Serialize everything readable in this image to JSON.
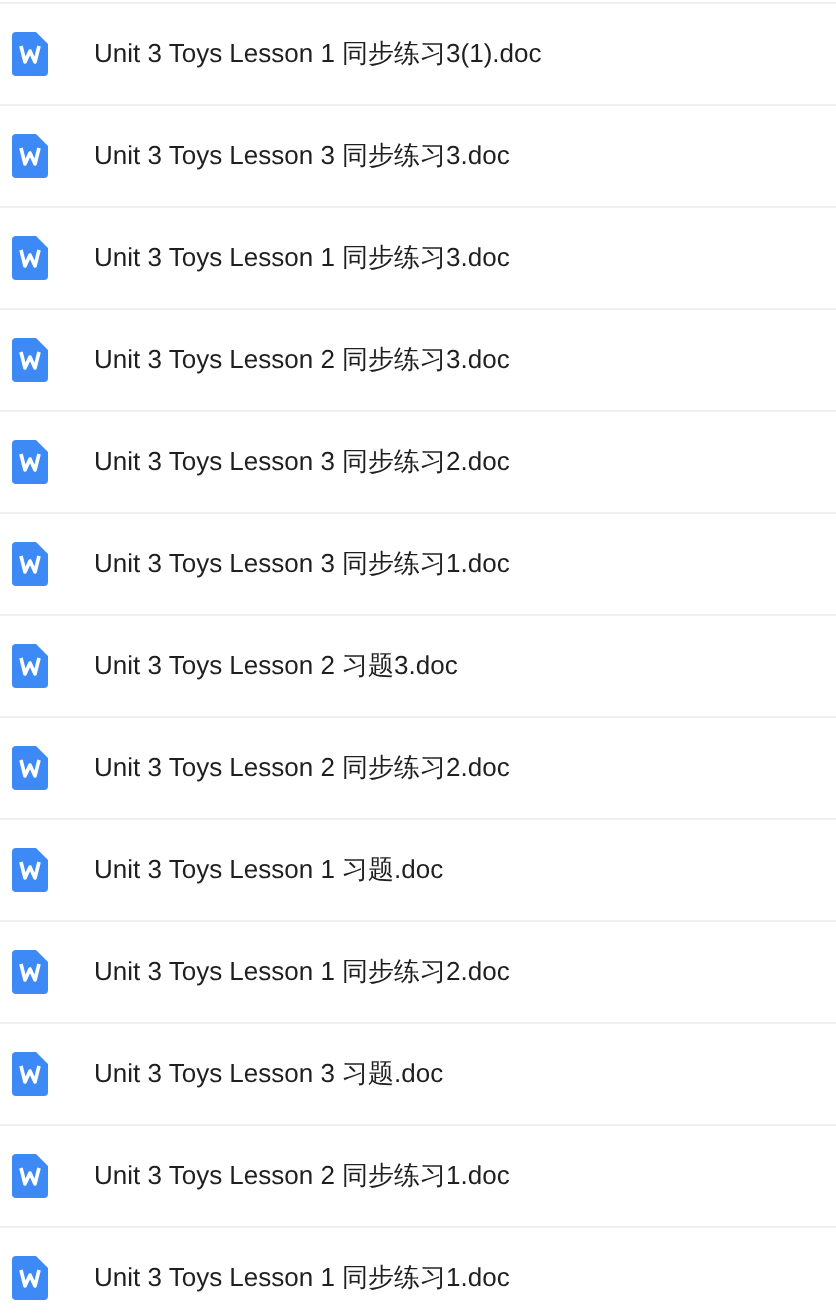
{
  "files": [
    {
      "name": "Unit 3 Toys Lesson 1 同步练习3(1).doc"
    },
    {
      "name": "Unit 3 Toys Lesson 3 同步练习3.doc"
    },
    {
      "name": "Unit 3 Toys Lesson 1 同步练习3.doc"
    },
    {
      "name": "Unit 3 Toys Lesson 2 同步练习3.doc"
    },
    {
      "name": "Unit 3 Toys Lesson 3 同步练习2.doc"
    },
    {
      "name": "Unit 3 Toys Lesson 3 同步练习1.doc"
    },
    {
      "name": "Unit 3 Toys Lesson 2 习题3.doc"
    },
    {
      "name": "Unit 3 Toys Lesson 2 同步练习2.doc"
    },
    {
      "name": "Unit 3 Toys Lesson 1 习题.doc"
    },
    {
      "name": "Unit 3 Toys Lesson 1 同步练习2.doc"
    },
    {
      "name": "Unit 3 Toys Lesson 3 习题.doc"
    },
    {
      "name": "Unit 3 Toys Lesson 2 同步练习1.doc"
    },
    {
      "name": "Unit 3 Toys Lesson 1 同步练习1.doc"
    }
  ]
}
